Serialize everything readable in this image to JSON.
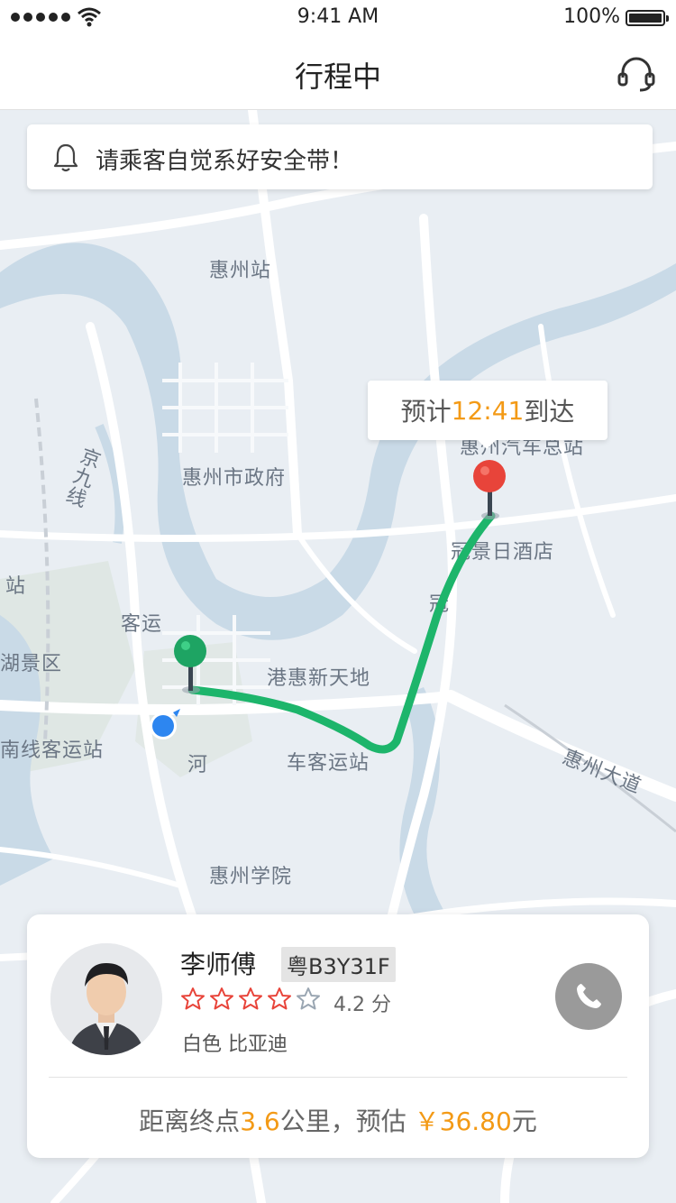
{
  "status_bar": {
    "time": "9:41 AM",
    "battery": "100%"
  },
  "nav": {
    "title": "行程中",
    "support_icon": "headset-icon"
  },
  "notice": {
    "icon": "bell-icon",
    "text": "请乘客自觉系好安全带！"
  },
  "map": {
    "labels": {
      "huizhou_station": "惠州站",
      "government": "惠州市政府",
      "hotel": "冠景日酒店",
      "bus_station_west": "客运",
      "scenic": "湖景区",
      "station_left": "站",
      "south_bus_station": "南线客运站",
      "gang_hui": "港惠新天地",
      "bus_station_center": "车客运站",
      "he": "河",
      "university": "惠州学院",
      "avenue": "惠州大道",
      "jingjiu": "京九线",
      "bus_terminal": "惠州汽车总站",
      "guan": "冠"
    },
    "route_color": "#1db56b",
    "start_pin_color": "#1ea463",
    "end_pin_color": "#e8443a",
    "location_color": "#2d86f0"
  },
  "eta": {
    "prefix": "预计",
    "time": "12:41",
    "suffix": "到达"
  },
  "driver": {
    "name": "李师傅",
    "plate": "粤B3Y31F",
    "stars_filled": 4,
    "stars_total": 5,
    "rating_text": "4.2 分",
    "car_color": "白色",
    "car_model": "比亚迪",
    "call_icon": "phone-icon"
  },
  "fare": {
    "distance_prefix": "距离终点",
    "distance": "3.6",
    "distance_unit": "公里，预估",
    "price": "￥36.80",
    "price_unit": "元"
  },
  "colors": {
    "accent": "#f39a16",
    "star": "#e8443a"
  }
}
